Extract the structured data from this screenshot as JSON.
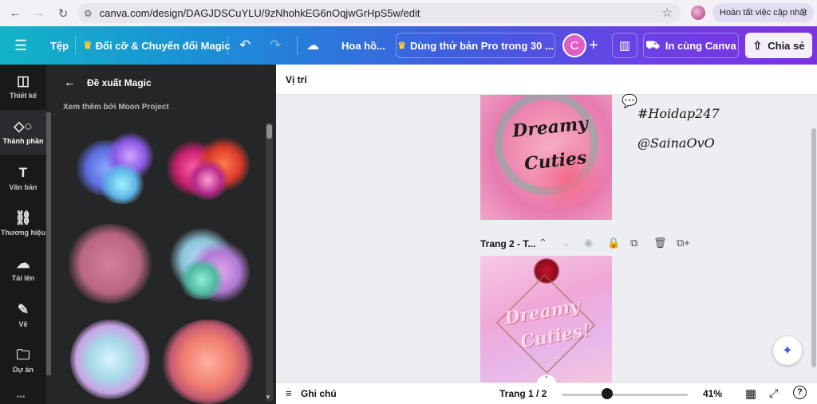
{
  "browser": {
    "url": "canva.com/design/DAGJDSCuYLU/9zNhohkEG6nOqjwGrHpS5w/edit",
    "update_label": "Hoàn tất việc cập nhật"
  },
  "topbar": {
    "file_label": "Tệp",
    "magic_label": "Đổi cỡ & Chuyển đổi Magic",
    "title_label": "Hoa hồ...",
    "pro_trial_label": "Dùng thử bản Pro trong 30 ...",
    "avatar_letter": "C",
    "print_label": "In cùng Canva",
    "share_label": "Chia sẻ"
  },
  "rail": {
    "items": [
      {
        "label": "Thiết kế",
        "icon": "layout-icon"
      },
      {
        "label": "Thành phần",
        "icon": "elements-icon"
      },
      {
        "label": "Văn bản",
        "icon": "text-icon"
      },
      {
        "label": "Thương hiệu",
        "icon": "brand-icon"
      },
      {
        "label": "Tải lên",
        "icon": "upload-icon"
      },
      {
        "label": "Vẽ",
        "icon": "draw-icon"
      },
      {
        "label": "Dự án",
        "icon": "folder-icon"
      }
    ]
  },
  "panel": {
    "title": "Đề xuất Magic",
    "subtitle": "Xem thêm bởi Moon Project"
  },
  "editor": {
    "toolbar_label": "Vị trí",
    "page1_line1": "Dreamy",
    "page1_line2": "Cuties",
    "hashtag": "#Hoidap247",
    "handle": "@SainaOvO",
    "page2_label": "Trang 2 - T...",
    "page2_line1": "Dreamy",
    "page2_line2": "Cuties!"
  },
  "bottombar": {
    "notes_label": "Ghi chú",
    "page_counter": "Trang 1 / 2",
    "zoom_label": "41%"
  },
  "colors": {
    "topbar_start": "#12b4c8",
    "topbar_end": "#7d32e2",
    "rail_bg": "#18191b",
    "panel_bg": "#252627"
  }
}
